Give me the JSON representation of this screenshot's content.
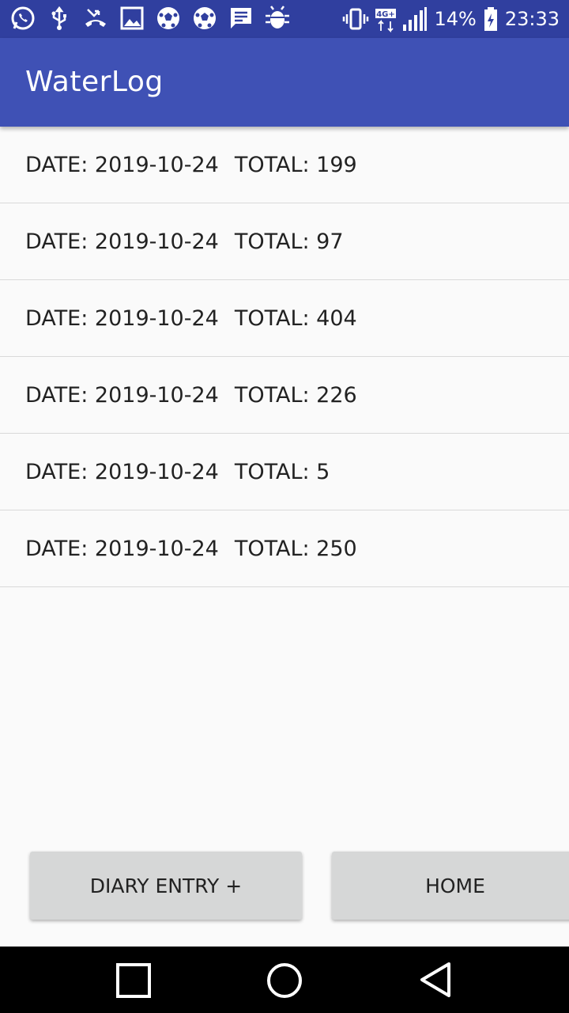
{
  "status_bar": {
    "battery": "14%",
    "time": "23:33",
    "network": "4G+",
    "left_icons": [
      "whatsapp-icon",
      "usb-icon",
      "missed-call-icon",
      "gallery-icon",
      "soccer-ball-icon",
      "soccer-ball-icon-2",
      "message-icon",
      "android-debug-icon"
    ]
  },
  "app_bar": {
    "title": "WaterLog"
  },
  "entries": [
    {
      "date_label": "DATE: 2019-10-24",
      "total_label": "TOTAL: 199"
    },
    {
      "date_label": "DATE: 2019-10-24",
      "total_label": "TOTAL: 97"
    },
    {
      "date_label": "DATE: 2019-10-24",
      "total_label": "TOTAL: 404"
    },
    {
      "date_label": "DATE: 2019-10-24",
      "total_label": "TOTAL: 226"
    },
    {
      "date_label": "DATE: 2019-10-24",
      "total_label": "TOTAL: 5"
    },
    {
      "date_label": "DATE: 2019-10-24",
      "total_label": "TOTAL: 250"
    }
  ],
  "buttons": {
    "diary_entry": "DIARY ENTRY +",
    "home": "HOME"
  },
  "colors": {
    "status_bar": "#303F9F",
    "app_bar": "#3F51B5",
    "button": "#D6D7D7"
  }
}
